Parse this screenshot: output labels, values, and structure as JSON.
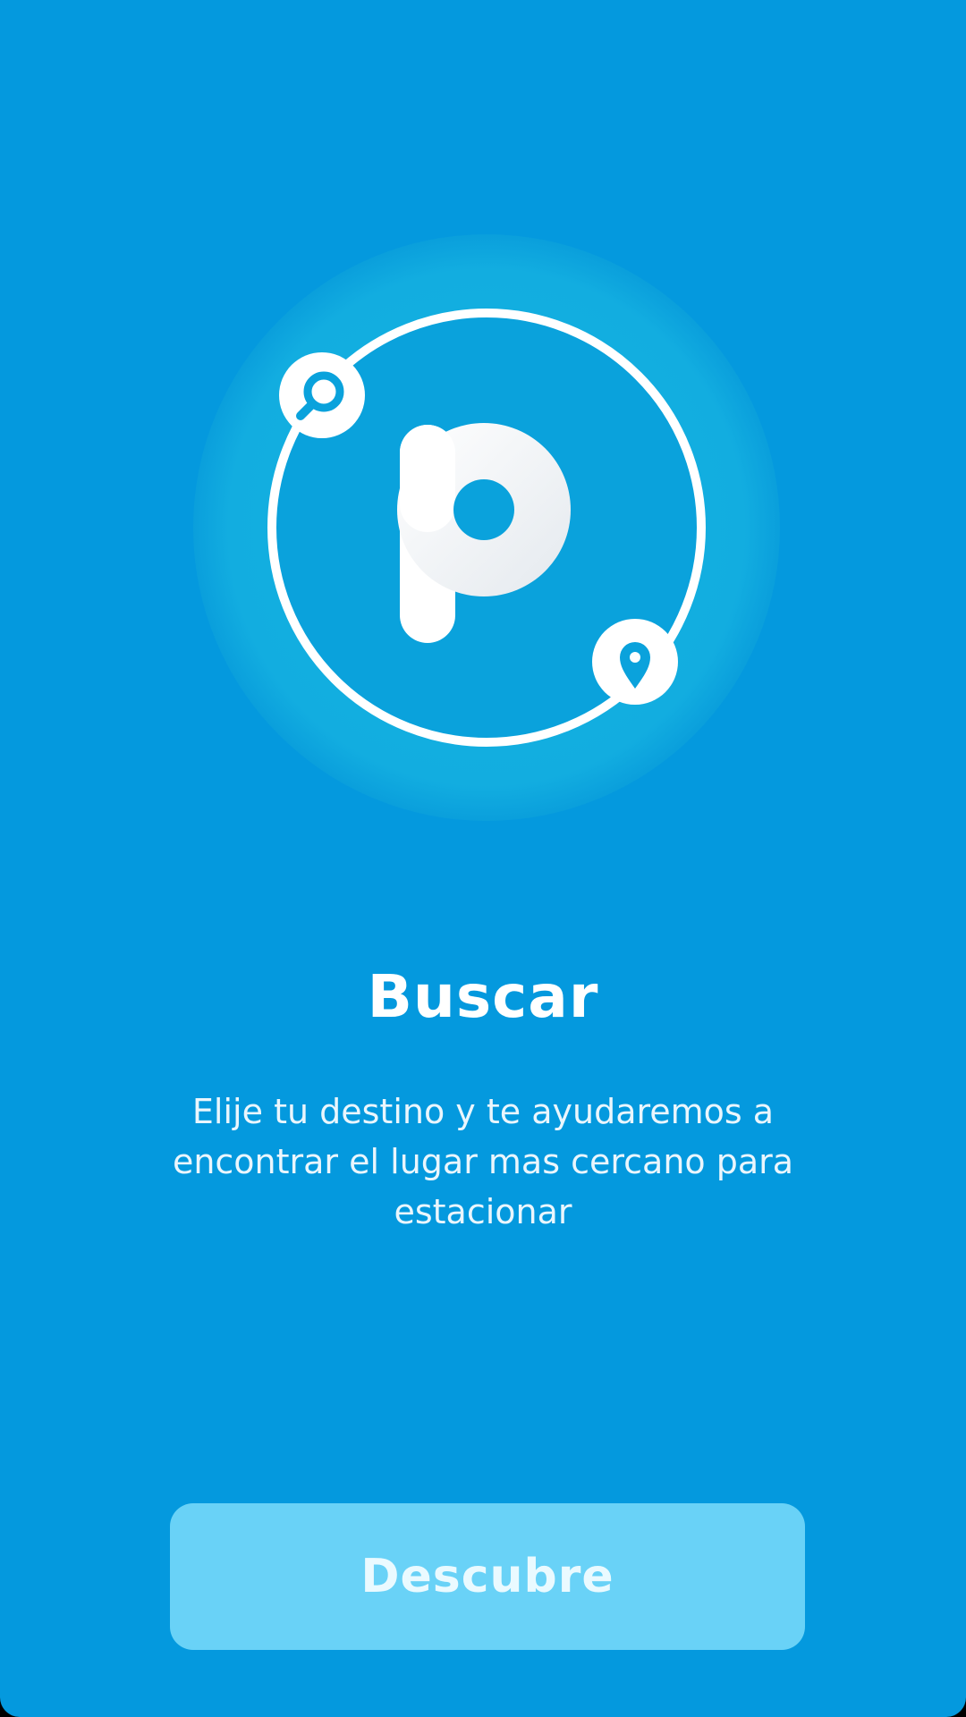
{
  "onboarding": {
    "title": "Buscar",
    "description": "Elije tu destino y te ayudaremos a encontrar el lugar mas cercano para estacionar",
    "cta_label": "Descubre"
  },
  "icons": {
    "hero": "parking-logo-icon",
    "search": "search-icon",
    "location": "location-pin-icon"
  },
  "colors": {
    "background": "#0499de",
    "halo": "#12afe0",
    "inner_disc": "#0aa2dc",
    "button": "#69d2f7",
    "text": "#ffffff"
  }
}
